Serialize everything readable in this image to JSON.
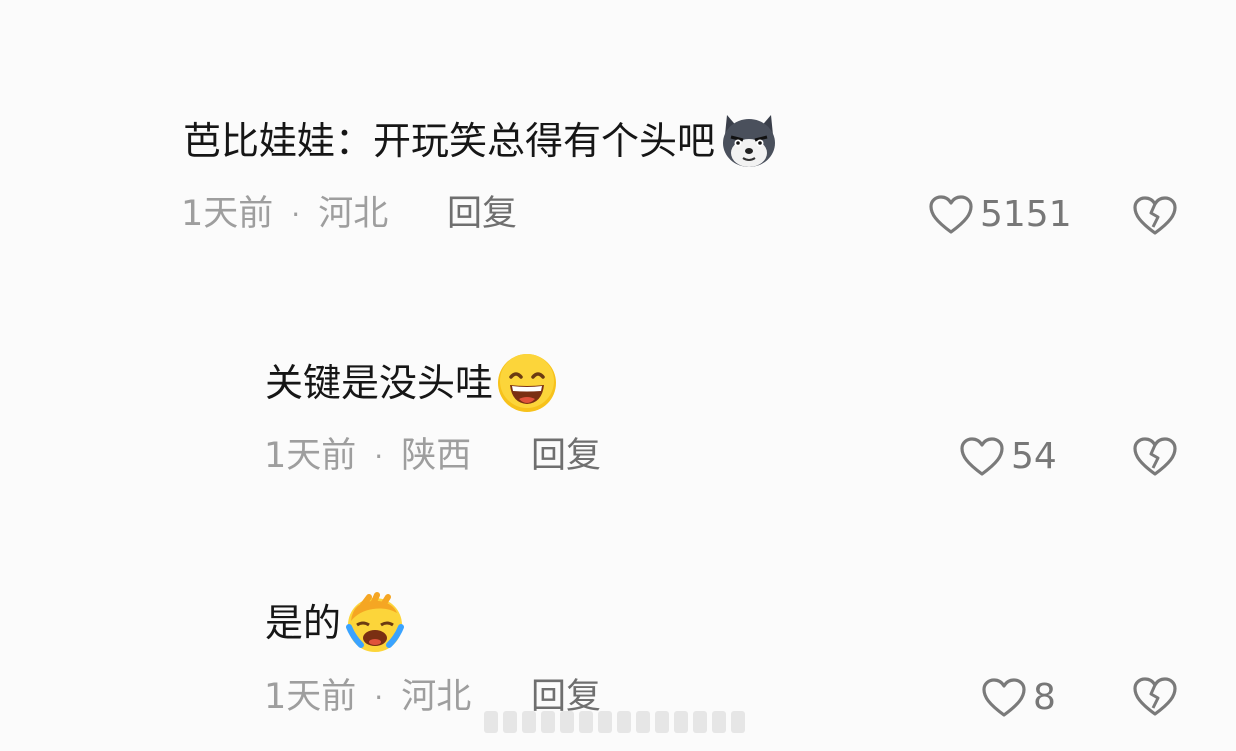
{
  "comments": [
    {
      "text": "芭比娃娃：开玩笑总得有个头吧",
      "emoji": "wolf-emoji",
      "time": "1天前",
      "location": "河北",
      "reply_label": "回复",
      "likes": "5151"
    },
    {
      "text": "关键是没头哇",
      "emoji": "grin-emoji",
      "time": "1天前",
      "location": "陕西",
      "reply_label": "回复",
      "likes": "54"
    },
    {
      "text": "是的",
      "emoji": "facepalm-cry-emoji",
      "time": "1天前",
      "location": "河北",
      "reply_label": "回复",
      "likes": "8"
    }
  ],
  "separator": "·",
  "colors": {
    "background": "#fbfbfb",
    "text": "#161616",
    "meta": "#9e9e9e",
    "icon": "#7a7a7a"
  }
}
